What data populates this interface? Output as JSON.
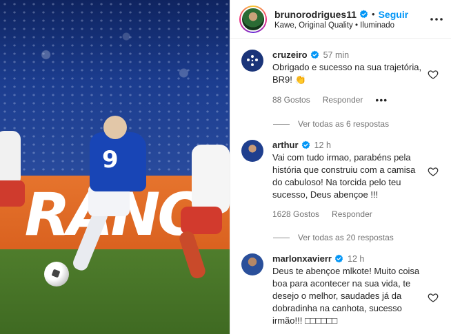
{
  "header": {
    "username": "brunorodrigues11",
    "verified": true,
    "separator": "•",
    "follow_label": "Seguir",
    "subtitle": "Kawe, Original Quality • Iluminado",
    "more_icon": "more-horizontal-icon"
  },
  "media": {
    "ad_text": "RANO",
    "shirt_number": "9"
  },
  "comments": [
    {
      "user": "cruzeiro",
      "verified": true,
      "time": "57 min",
      "text": "Obrigado e sucesso na sua trajetória, BR9! 👏",
      "likes": "88 Gostos",
      "reply_label": "Responder",
      "more_label": "•••",
      "replies_label": "Ver todas as 6 respostas"
    },
    {
      "user": "arthur",
      "verified": true,
      "time": "12 h",
      "text": "Vai com tudo irmao, parabéns pela história que construiu com a camisa do cabuloso! Na torcida pelo teu sucesso, Deus abençoe !!!",
      "likes": "1628 Gostos",
      "reply_label": "Responder",
      "replies_label": "Ver todas as 20 respostas"
    },
    {
      "user": "marlonxavierr",
      "verified": true,
      "time": "12 h",
      "text": "Deus te abençoe mlkote! Muito coisa boa para acontecer na sua vida, te desejo o melhor, saudades já da dobradinha na canhota, sucesso irmão!!! □□□□□□"
    }
  ],
  "colors": {
    "accent": "#0095f6",
    "text": "#262626",
    "muted": "#737373",
    "verified": "#0095f6"
  }
}
